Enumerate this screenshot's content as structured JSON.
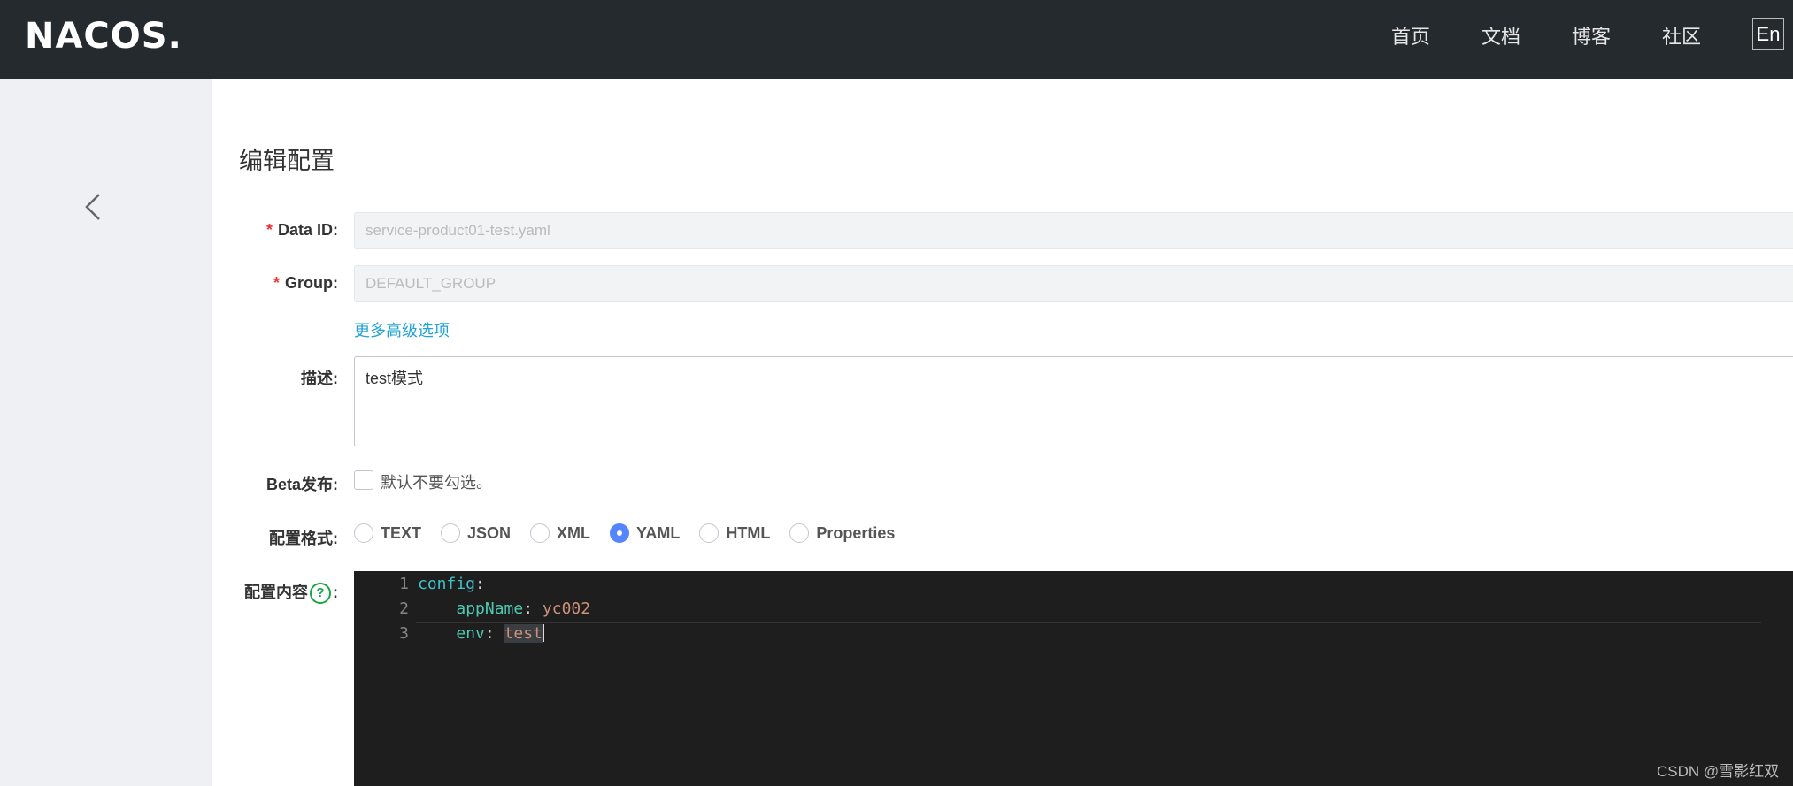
{
  "header": {
    "logo": "NACOS.",
    "nav": [
      "首页",
      "文档",
      "博客",
      "社区"
    ],
    "lang": "En"
  },
  "page": {
    "title": "编辑配置"
  },
  "form": {
    "data_id": {
      "label": "Data ID:",
      "value": "service-product01-test.yaml"
    },
    "group": {
      "label": "Group:",
      "value": "DEFAULT_GROUP"
    },
    "advanced_link": "更多高级选项",
    "description": {
      "label": "描述:",
      "value": "test模式"
    },
    "beta": {
      "label": "Beta发布:",
      "text": "默认不要勾选。"
    },
    "format": {
      "label": "配置格式:",
      "options": [
        "TEXT",
        "JSON",
        "XML",
        "YAML",
        "HTML",
        "Properties"
      ],
      "selected": "YAML"
    },
    "content": {
      "label": "配置内容",
      "help": "?",
      "line_numbers": [
        "1",
        "2",
        "3"
      ],
      "lines": [
        {
          "key": "config",
          "sep": ":",
          "value": ""
        },
        {
          "indent": "    ",
          "key": "appName",
          "sep": ": ",
          "value": "yc002"
        },
        {
          "indent": "    ",
          "key": "env",
          "sep": ": ",
          "value": "test"
        }
      ]
    }
  },
  "watermark": "CSDN @雪影红双",
  "colors": {
    "topbar": "#252a2f",
    "sidebar": "#eef0f4",
    "link": "#20a3d6",
    "radio_on": "#5584ff",
    "editor_bg": "#1e1e1e"
  }
}
